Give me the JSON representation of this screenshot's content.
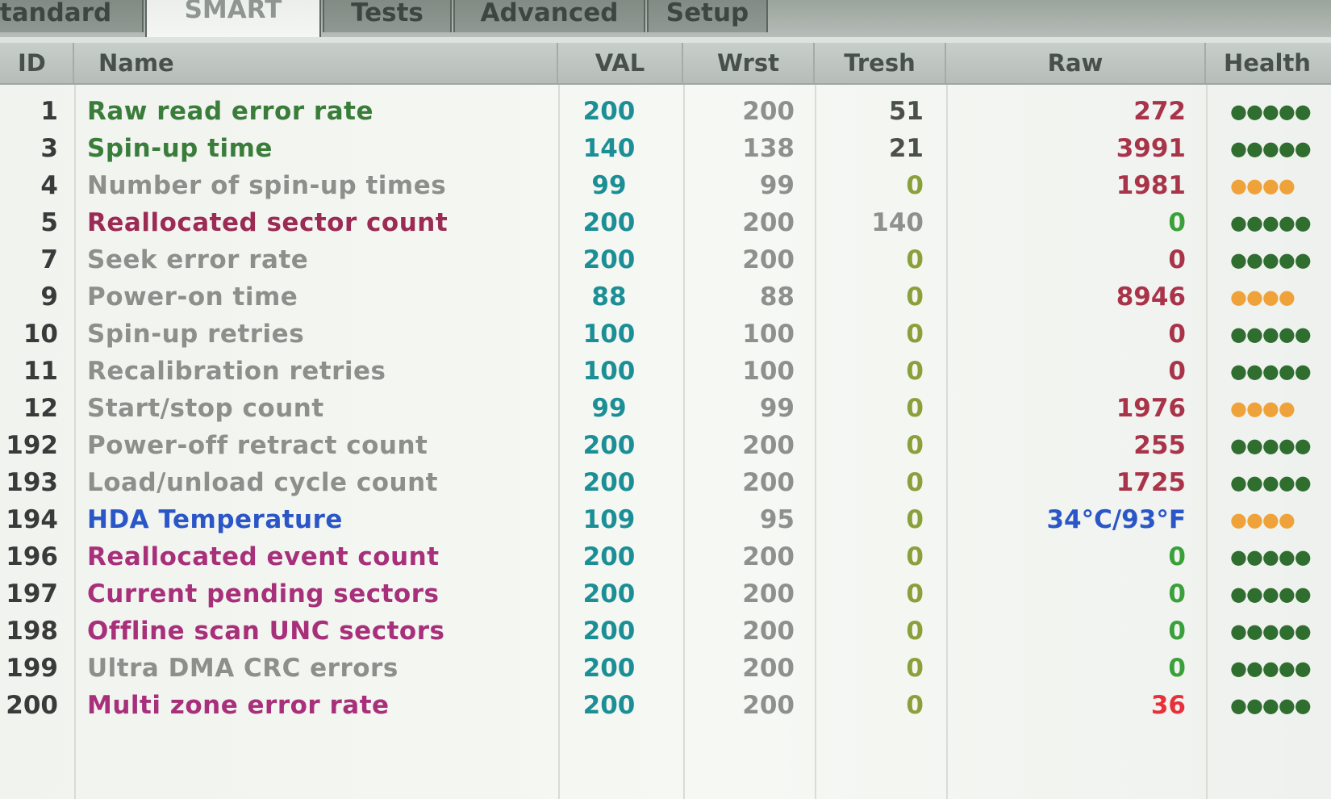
{
  "tabs": [
    {
      "label": "tandard",
      "active": false
    },
    {
      "label": "SMART",
      "active": true
    },
    {
      "label": "Tests",
      "active": false
    },
    {
      "label": "Advanced",
      "active": false
    },
    {
      "label": "Setup",
      "active": false
    }
  ],
  "columns": {
    "id": "ID",
    "name": "Name",
    "val": "VAL",
    "wrst": "Wrst",
    "tresh": "Tresh",
    "raw": "Raw",
    "health": "Health"
  },
  "colors": {
    "green": "#3a7d3a",
    "grey": "#8b908b",
    "magenta": "#a8307a",
    "crimson": "#9b2a55",
    "blue": "#2a56c8",
    "teal": "#1b8f95",
    "raw_red": "#a9344a",
    "raw_green": "#3aa03a",
    "raw_bright_red": "#e8303a",
    "health_green": "#2f6e2f",
    "health_orange": "#f0a23a"
  },
  "rows": [
    {
      "id": "1",
      "name": "Raw read error rate",
      "val": "200",
      "wrst": "200",
      "tresh": "51",
      "raw": "272",
      "health": "●●●●●",
      "name_color": "green",
      "tresh_color": "#4a504a",
      "raw_color": "raw_red",
      "health_color": "health_green"
    },
    {
      "id": "3",
      "name": "Spin-up time",
      "val": "140",
      "wrst": "138",
      "tresh": "21",
      "raw": "3991",
      "health": "●●●●●",
      "name_color": "green",
      "tresh_color": "#4a504a",
      "raw_color": "raw_red",
      "health_color": "health_green"
    },
    {
      "id": "4",
      "name": "Number of spin-up times",
      "val": "99",
      "wrst": "99",
      "tresh": "0",
      "raw": "1981",
      "health": "●●●●",
      "name_color": "grey",
      "tresh_color": "#8aa03a",
      "raw_color": "raw_red",
      "health_color": "health_orange"
    },
    {
      "id": "5",
      "name": "Reallocated sector count",
      "val": "200",
      "wrst": "200",
      "tresh": "140",
      "raw": "0",
      "health": "●●●●●",
      "name_color": "crimson",
      "tresh_color": "#8d918d",
      "raw_color": "raw_green",
      "health_color": "health_green"
    },
    {
      "id": "7",
      "name": "Seek error rate",
      "val": "200",
      "wrst": "200",
      "tresh": "0",
      "raw": "0",
      "health": "●●●●●",
      "name_color": "grey",
      "tresh_color": "#8aa03a",
      "raw_color": "raw_red",
      "health_color": "health_green"
    },
    {
      "id": "9",
      "name": "Power-on time",
      "val": "88",
      "wrst": "88",
      "tresh": "0",
      "raw": "8946",
      "health": "●●●●",
      "name_color": "grey",
      "tresh_color": "#8aa03a",
      "raw_color": "raw_red",
      "health_color": "health_orange"
    },
    {
      "id": "10",
      "name": "Spin-up retries",
      "val": "100",
      "wrst": "100",
      "tresh": "0",
      "raw": "0",
      "health": "●●●●●",
      "name_color": "grey",
      "tresh_color": "#8aa03a",
      "raw_color": "raw_red",
      "health_color": "health_green"
    },
    {
      "id": "11",
      "name": "Recalibration retries",
      "val": "100",
      "wrst": "100",
      "tresh": "0",
      "raw": "0",
      "health": "●●●●●",
      "name_color": "grey",
      "tresh_color": "#8aa03a",
      "raw_color": "raw_red",
      "health_color": "health_green"
    },
    {
      "id": "12",
      "name": "Start/stop count",
      "val": "99",
      "wrst": "99",
      "tresh": "0",
      "raw": "1976",
      "health": "●●●●",
      "name_color": "grey",
      "tresh_color": "#8aa03a",
      "raw_color": "raw_red",
      "health_color": "health_orange"
    },
    {
      "id": "192",
      "name": "Power-off retract count",
      "val": "200",
      "wrst": "200",
      "tresh": "0",
      "raw": "255",
      "health": "●●●●●",
      "name_color": "grey",
      "tresh_color": "#8aa03a",
      "raw_color": "raw_red",
      "health_color": "health_green"
    },
    {
      "id": "193",
      "name": "Load/unload cycle count",
      "val": "200",
      "wrst": "200",
      "tresh": "0",
      "raw": "1725",
      "health": "●●●●●",
      "name_color": "grey",
      "tresh_color": "#8aa03a",
      "raw_color": "raw_red",
      "health_color": "health_green"
    },
    {
      "id": "194",
      "name": "HDA Temperature",
      "val": "109",
      "wrst": "95",
      "tresh": "0",
      "raw": "34°C/93°F",
      "health": "●●●●",
      "name_color": "blue",
      "tresh_color": "#8aa03a",
      "raw_color": "blue",
      "health_color": "health_orange"
    },
    {
      "id": "196",
      "name": "Reallocated event count",
      "val": "200",
      "wrst": "200",
      "tresh": "0",
      "raw": "0",
      "health": "●●●●●",
      "name_color": "magenta",
      "tresh_color": "#8aa03a",
      "raw_color": "raw_green",
      "health_color": "health_green"
    },
    {
      "id": "197",
      "name": "Current pending sectors",
      "val": "200",
      "wrst": "200",
      "tresh": "0",
      "raw": "0",
      "health": "●●●●●",
      "name_color": "magenta",
      "tresh_color": "#8aa03a",
      "raw_color": "raw_green",
      "health_color": "health_green"
    },
    {
      "id": "198",
      "name": "Offline scan UNC sectors",
      "val": "200",
      "wrst": "200",
      "tresh": "0",
      "raw": "0",
      "health": "●●●●●",
      "name_color": "magenta",
      "tresh_color": "#8aa03a",
      "raw_color": "raw_green",
      "health_color": "health_green"
    },
    {
      "id": "199",
      "name": "Ultra DMA CRC errors",
      "val": "200",
      "wrst": "200",
      "tresh": "0",
      "raw": "0",
      "health": "●●●●●",
      "name_color": "grey",
      "tresh_color": "#8aa03a",
      "raw_color": "raw_green",
      "health_color": "health_green"
    },
    {
      "id": "200",
      "name": "Multi zone error rate",
      "val": "200",
      "wrst": "200",
      "tresh": "0",
      "raw": "36",
      "health": "●●●●●",
      "name_color": "magenta",
      "tresh_color": "#8aa03a",
      "raw_color": "raw_bright_red",
      "health_color": "health_green"
    }
  ]
}
